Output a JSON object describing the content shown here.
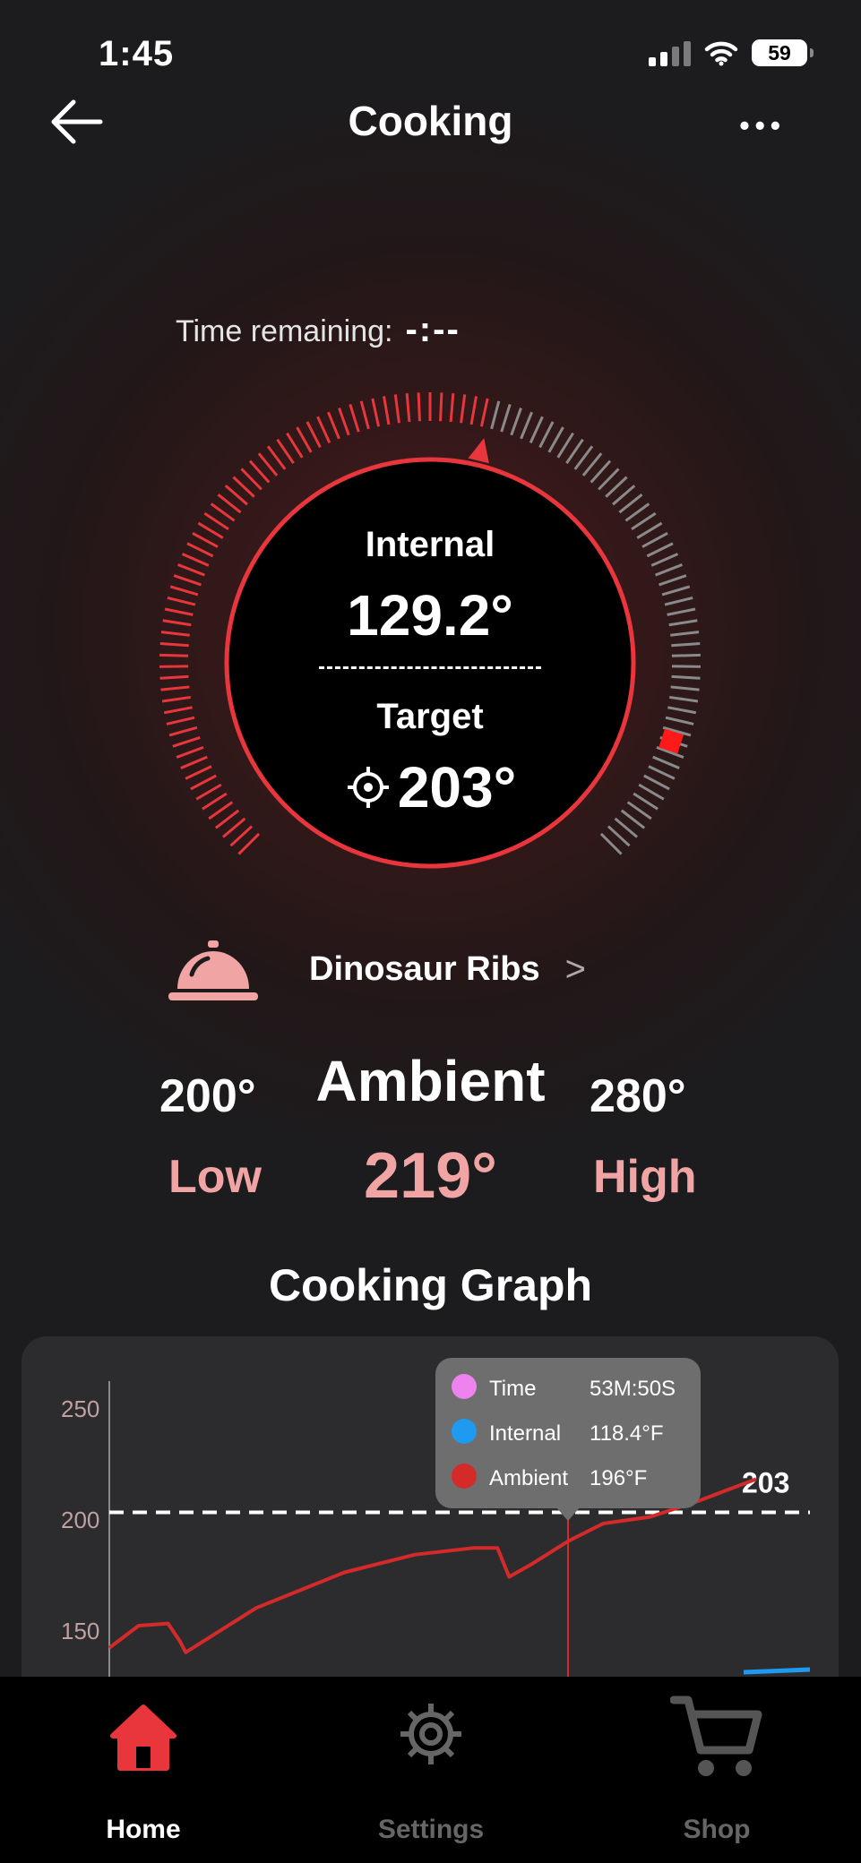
{
  "status_bar": {
    "time": "1:45",
    "battery": "59"
  },
  "header": {
    "title": "Cooking",
    "back_icon": "arrow-left-icon",
    "more_icon": "more-dots-icon"
  },
  "timer": {
    "label": "Time remaining:",
    "value": "-:--"
  },
  "probe": {
    "internal_label": "Internal",
    "internal_value": "129.2°",
    "target_label": "Target",
    "target_value": "203°",
    "progress_fraction": 0.55,
    "accent": "#e8363c"
  },
  "recipe": {
    "name": "Dinosaur Ribs",
    "icon": "service-bell-icon"
  },
  "ambient": {
    "title": "Ambient",
    "value": "219°",
    "low_value": "200°",
    "low_label": "Low",
    "high_value": "280°",
    "high_label": "High"
  },
  "graph": {
    "title": "Cooking Graph",
    "target_label": "203",
    "tooltip": [
      {
        "label": "Time",
        "value": "53M:50S",
        "color": "#ee82ee"
      },
      {
        "label": "Internal",
        "value": "118.4°F",
        "color": "#1e9bf0"
      },
      {
        "label": "Ambient",
        "value": "196°F",
        "color": "#d42a2a"
      }
    ]
  },
  "chart_data": {
    "type": "line",
    "y_ticks": [
      250,
      200,
      150
    ],
    "ylim": [
      120,
      265
    ],
    "target_line": 203,
    "series": [
      {
        "name": "Ambient",
        "color": "#d42a2a",
        "points": [
          [
            0,
            142
          ],
          [
            0.05,
            152
          ],
          [
            0.1,
            153
          ],
          [
            0.12,
            145
          ],
          [
            0.13,
            140
          ],
          [
            0.16,
            145
          ],
          [
            0.25,
            160
          ],
          [
            0.4,
            176
          ],
          [
            0.52,
            184
          ],
          [
            0.62,
            187
          ],
          [
            0.66,
            187
          ],
          [
            0.68,
            174
          ],
          [
            0.72,
            180
          ],
          [
            0.78,
            190
          ],
          [
            0.84,
            198
          ],
          [
            0.92,
            201
          ],
          [
            1.0,
            208
          ],
          [
            1.05,
            213
          ],
          [
            1.1,
            218
          ]
        ]
      }
    ],
    "grid": false
  },
  "nav": {
    "items": [
      {
        "label": "Home",
        "icon": "home-icon",
        "active": true
      },
      {
        "label": "Settings",
        "icon": "gear-icon",
        "active": false
      },
      {
        "label": "Shop",
        "icon": "cart-icon",
        "active": false
      }
    ]
  }
}
